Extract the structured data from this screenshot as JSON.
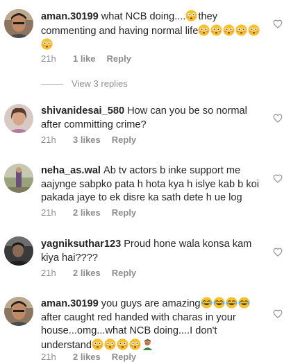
{
  "comments": [
    {
      "username": "aman.30199",
      "text_before": "what NCB doing....",
      "text_after": "they commenting and having normal life",
      "time": "21h",
      "likes": "1 like",
      "reply": "Reply"
    },
    {
      "username": "shivanidesai_580",
      "text": "How can you be so normal after committing crime?",
      "time": "21h",
      "likes": "3 likes",
      "reply": "Reply"
    },
    {
      "username": "neha_as.wal",
      "text": "Ab tv actors b inke support me aajynge sabpko pata h hota kya h islye kab b koi pakada jaye to ek disre ka sath dete h ue log",
      "time": "21h",
      "likes": "2 likes",
      "reply": "Reply"
    },
    {
      "username": "yagniksuthar123",
      "text": "Proud hone wala konsa kam kiya hai????",
      "time": "21h",
      "likes": "2 likes",
      "reply": "Reply"
    },
    {
      "username": "aman.30199",
      "text_before": "you guys are amazing",
      "text_middle": "after caught red handed with charas in your house...omg...what NCB doing....I don't understand",
      "time": "21h",
      "likes": "2 likes",
      "reply": "Reply"
    }
  ],
  "view_replies": "View 3 replies",
  "icons": {
    "heart": "heart-outline-icon",
    "flushed_emoji": "flushed-face-emoji",
    "joy_emoji": "tears-of-joy-emoji",
    "facepalm_emoji": "man-facepalming-emoji"
  },
  "colors": {
    "text": "#262626",
    "meta": "#8e8e8e",
    "emoji": "#f7c12e"
  }
}
